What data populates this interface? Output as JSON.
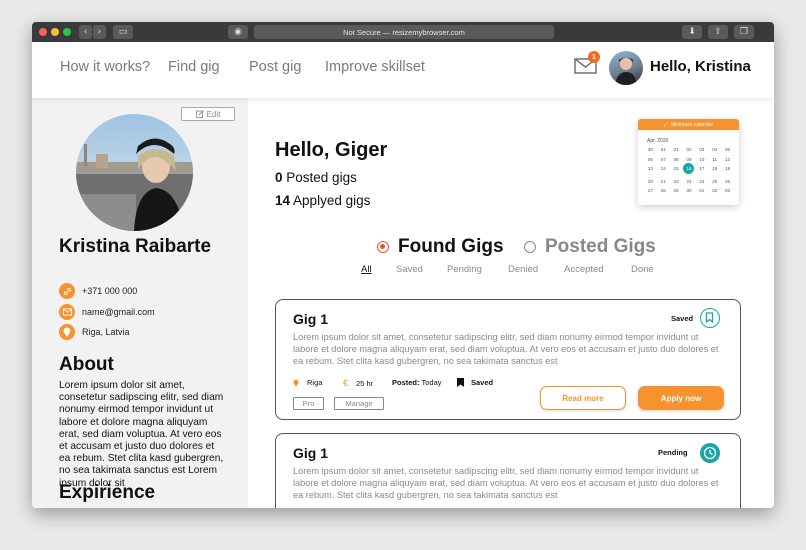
{
  "browser": {
    "url": "Not Secure — resizemybrowser.com"
  },
  "nav": {
    "links": [
      "How it works?",
      "Find gig",
      "Post gig",
      "Improve skillset"
    ],
    "mail_badge": "1",
    "greeting": "Hello, Kristina"
  },
  "sidebar": {
    "edit_label": "Edit",
    "name": "Kristina Raibarte",
    "phone": "+371 000 000",
    "email": "name@gmail.com",
    "location": "Riga, Latvia",
    "about_heading": "About",
    "about_text": "Lorem ipsum dolor sit amet, consetetur sadipscing elitr, sed diam nonumy eirmod tempor invidunt ut labore et dolore magna aliquyam erat, sed diam voluptua. At vero eos et accusam et justo duo dolores et ea rebum. Stet clita kasd gubergren, no sea takimata sanctus est Lorem ipsum dolor sit",
    "experience_heading": "Expirience"
  },
  "main": {
    "hello": "Hello, Giger",
    "posted_count": "0",
    "posted_label": "Posted gigs",
    "applied_count": "14",
    "applied_label": "Applyed gigs"
  },
  "calendar": {
    "title": "Minimaze calendar",
    "month": "Apr. 2020",
    "days": [
      "30",
      "31",
      "01",
      "02",
      "03",
      "04",
      "05",
      "06",
      "07",
      "08",
      "09",
      "10",
      "11",
      "12",
      "13",
      "14",
      "15",
      "16",
      "17",
      "18",
      "19",
      "20",
      "21",
      "22",
      "23",
      "24",
      "25",
      "26",
      "27",
      "28",
      "29",
      "30",
      "01",
      "02",
      "03"
    ],
    "selected": "16"
  },
  "toggle": {
    "found": "Found Gigs",
    "posted": "Posted Gigs"
  },
  "filters": [
    "All",
    "Saved",
    "Pending",
    "Denied",
    "Accepted",
    "Done"
  ],
  "cards": [
    {
      "title": "Gig 1",
      "status": "Saved",
      "status_icon": "bookmark-icon",
      "status_color": "#1aa6a6",
      "description": "Lorem ipsum dolor sit amet, consetetur sadipscing elitr, sed diam nonumy eirmod tempor invidunt ut labore et dolore magna aliquyam erat, sed diam voluptua. At vero eos et accusam et justo duo dolores et ea rebum. Stet clita kasd gubergren, no sea takimata sanctus est",
      "location": "Riga",
      "hours": "25 hr",
      "posted_label": "Posted:",
      "posted_value": "Today",
      "saved_label": "Saved",
      "tags": [
        "Pro",
        "Manage"
      ],
      "read_more": "Read more",
      "apply": "Apply now"
    },
    {
      "title": "Gig 1",
      "status": "Pending",
      "status_icon": "clock-icon",
      "status_color": "#1aa6a6",
      "description": "Lorem ipsum dolor sit amet, consetetur sadipscing elitr, sed diam nonumy eirmod tempor invidunt ut labore et dolore magna aliquyam erat, sed diam voluptua. At vero eos et accusam et justo duo dolores et ea rebum. Stet clita kasd gubergren, no sea takimata sanctus est"
    }
  ],
  "colors": {
    "accent": "#f7932f",
    "teal": "#1aa6a6",
    "radio_on": "#e9542d"
  }
}
